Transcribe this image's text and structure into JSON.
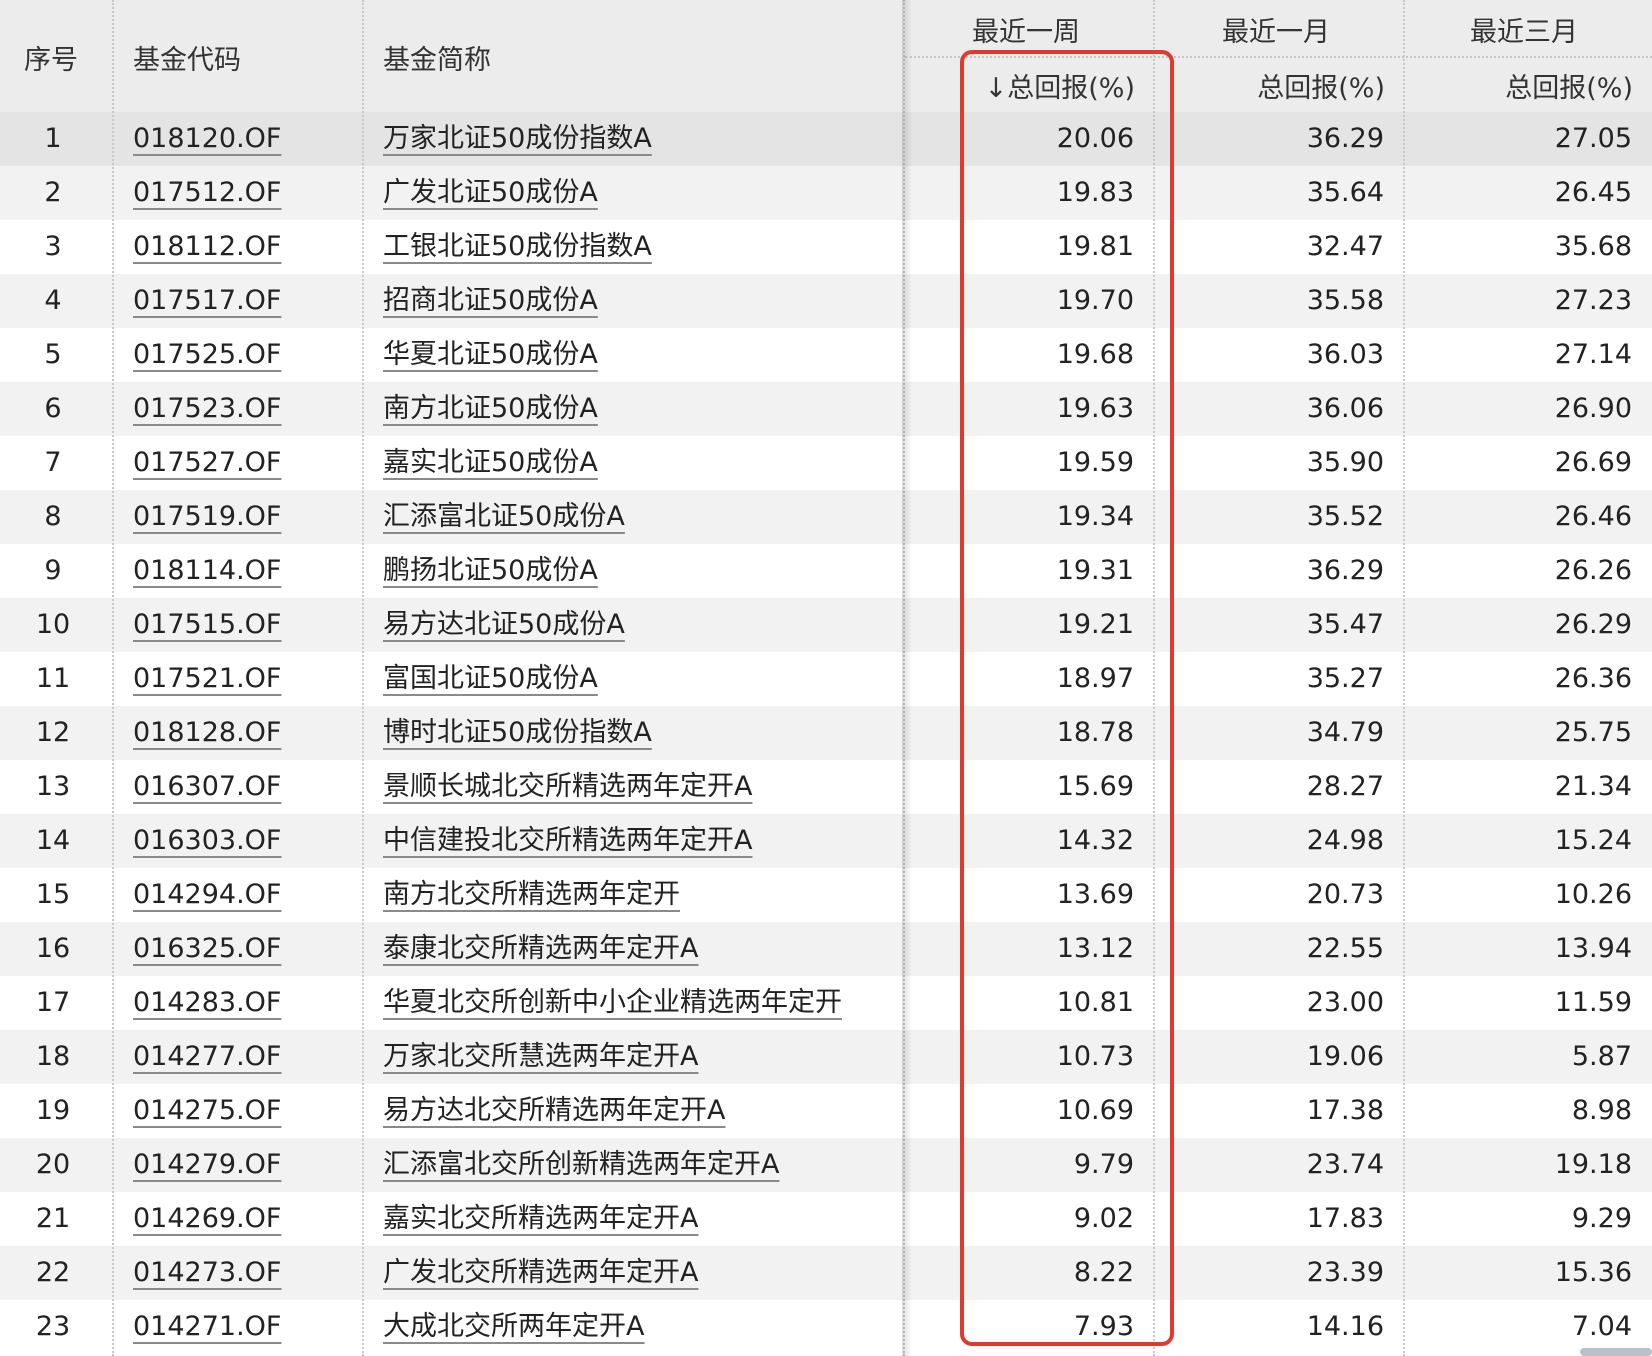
{
  "header": {
    "col_index": "序号",
    "col_code": "基金代码",
    "col_name": "基金简称",
    "group_week": "最近一周",
    "group_month": "最近一月",
    "group_quarter": "最近三月",
    "sort_arrow": "↓",
    "sub_week": "总回报(%)",
    "sub_month": "总回报(%)",
    "sub_quarter": "总回报(%)"
  },
  "rows": [
    {
      "idx": "1",
      "code": "018120.OF",
      "name": "万家北证50成份指数A",
      "week": "20.06",
      "month": "36.29",
      "quarter": "27.05"
    },
    {
      "idx": "2",
      "code": "017512.OF",
      "name": "广发北证50成份A",
      "week": "19.83",
      "month": "35.64",
      "quarter": "26.45"
    },
    {
      "idx": "3",
      "code": "018112.OF",
      "name": "工银北证50成份指数A",
      "week": "19.81",
      "month": "32.47",
      "quarter": "35.68"
    },
    {
      "idx": "4",
      "code": "017517.OF",
      "name": "招商北证50成份A",
      "week": "19.70",
      "month": "35.58",
      "quarter": "27.23"
    },
    {
      "idx": "5",
      "code": "017525.OF",
      "name": "华夏北证50成份A",
      "week": "19.68",
      "month": "36.03",
      "quarter": "27.14"
    },
    {
      "idx": "6",
      "code": "017523.OF",
      "name": "南方北证50成份A",
      "week": "19.63",
      "month": "36.06",
      "quarter": "26.90"
    },
    {
      "idx": "7",
      "code": "017527.OF",
      "name": "嘉实北证50成份A",
      "week": "19.59",
      "month": "35.90",
      "quarter": "26.69"
    },
    {
      "idx": "8",
      "code": "017519.OF",
      "name": "汇添富北证50成份A",
      "week": "19.34",
      "month": "35.52",
      "quarter": "26.46"
    },
    {
      "idx": "9",
      "code": "018114.OF",
      "name": "鹏扬北证50成份A",
      "week": "19.31",
      "month": "36.29",
      "quarter": "26.26"
    },
    {
      "idx": "10",
      "code": "017515.OF",
      "name": "易方达北证50成份A",
      "week": "19.21",
      "month": "35.47",
      "quarter": "26.29"
    },
    {
      "idx": "11",
      "code": "017521.OF",
      "name": "富国北证50成份A",
      "week": "18.97",
      "month": "35.27",
      "quarter": "26.36"
    },
    {
      "idx": "12",
      "code": "018128.OF",
      "name": "博时北证50成份指数A",
      "week": "18.78",
      "month": "34.79",
      "quarter": "25.75"
    },
    {
      "idx": "13",
      "code": "016307.OF",
      "name": "景顺长城北交所精选两年定开A",
      "week": "15.69",
      "month": "28.27",
      "quarter": "21.34"
    },
    {
      "idx": "14",
      "code": "016303.OF",
      "name": "中信建投北交所精选两年定开A",
      "week": "14.32",
      "month": "24.98",
      "quarter": "15.24"
    },
    {
      "idx": "15",
      "code": "014294.OF",
      "name": "南方北交所精选两年定开",
      "week": "13.69",
      "month": "20.73",
      "quarter": "10.26"
    },
    {
      "idx": "16",
      "code": "016325.OF",
      "name": "泰康北交所精选两年定开A",
      "week": "13.12",
      "month": "22.55",
      "quarter": "13.94"
    },
    {
      "idx": "17",
      "code": "014283.OF",
      "name": "华夏北交所创新中小企业精选两年定开",
      "week": "10.81",
      "month": "23.00",
      "quarter": "11.59"
    },
    {
      "idx": "18",
      "code": "014277.OF",
      "name": "万家北交所慧选两年定开A",
      "week": "10.73",
      "month": "19.06",
      "quarter": "5.87"
    },
    {
      "idx": "19",
      "code": "014275.OF",
      "name": "易方达北交所精选两年定开A",
      "week": "10.69",
      "month": "17.38",
      "quarter": "8.98"
    },
    {
      "idx": "20",
      "code": "014279.OF",
      "name": "汇添富北交所创新精选两年定开A",
      "week": "9.79",
      "month": "23.74",
      "quarter": "19.18"
    },
    {
      "idx": "21",
      "code": "014269.OF",
      "name": "嘉实北交所精选两年定开A",
      "week": "9.02",
      "month": "17.83",
      "quarter": "9.29"
    },
    {
      "idx": "22",
      "code": "014273.OF",
      "name": "广发北交所精选两年定开A",
      "week": "8.22",
      "month": "23.39",
      "quarter": "15.36"
    },
    {
      "idx": "23",
      "code": "014271.OF",
      "name": "大成北交所两年定开A",
      "week": "7.93",
      "month": "14.16",
      "quarter": "7.04"
    }
  ],
  "colors": {
    "header_bg": "#ececec",
    "row_odd_bg": "#ffffff",
    "row_even_bg": "#f2f2f2",
    "selected_row_bg": "#e4e4e4",
    "highlight_border": "#e03a2f"
  }
}
